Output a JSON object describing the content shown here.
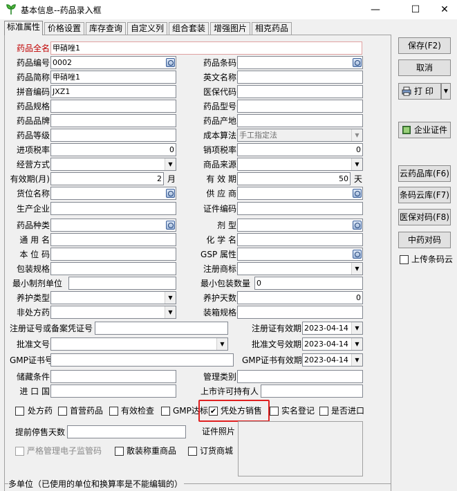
{
  "window": {
    "title": "基本信息--药品录入框",
    "minimize": "—",
    "maximize": "☐",
    "close": "✕"
  },
  "tabs": [
    "标准属性",
    "价格设置",
    "库存查询",
    "自定义列",
    "组合套装",
    "增强图片",
    "相克药品"
  ],
  "fields": {
    "full_name": {
      "label": "药品全名",
      "value": "甲硝唑1"
    },
    "code": {
      "label": "药品编号",
      "value": "0002"
    },
    "short_name": {
      "label": "药品简称",
      "value": "甲硝唑1"
    },
    "pinyin": {
      "label": "拼音编码",
      "value": "JXZ1"
    },
    "spec": {
      "label": "药品规格",
      "value": ""
    },
    "brand": {
      "label": "药品品牌",
      "value": ""
    },
    "grade": {
      "label": "药品等级",
      "value": ""
    },
    "input_tax": {
      "label": "进项税率",
      "value": "0"
    },
    "biz_mode": {
      "label": "经营方式",
      "value": ""
    },
    "validity": {
      "label": "有效期(月)",
      "value": "2",
      "unit": "月"
    },
    "location": {
      "label": "货位名称",
      "value": ""
    },
    "manufacturer": {
      "label": "生产企业",
      "value": ""
    },
    "category": {
      "label": "药品种类",
      "value": ""
    },
    "generic": {
      "label": "通 用 名",
      "value": ""
    },
    "base_unit": {
      "label": "本 位 码",
      "value": ""
    },
    "package_spec": {
      "label": "包装规格",
      "value": ""
    },
    "min_unit": {
      "label": "最小制剂单位",
      "value": ""
    },
    "care_type": {
      "label": "养护类型",
      "value": ""
    },
    "otc": {
      "label": "非处方药",
      "value": ""
    },
    "barcode": {
      "label": "药品条码",
      "value": ""
    },
    "en_name": {
      "label": "英文名称",
      "value": ""
    },
    "insurance": {
      "label": "医保代码",
      "value": ""
    },
    "model": {
      "label": "药品型号",
      "value": ""
    },
    "origin": {
      "label": "药品产地",
      "value": ""
    },
    "cost_method": {
      "label": "成本算法",
      "value": "手工指定法"
    },
    "output_tax": {
      "label": "销项税率",
      "value": "0"
    },
    "source": {
      "label": "商品来源",
      "value": ""
    },
    "validity_days": {
      "label": "有 效 期",
      "value": "50",
      "unit": "天"
    },
    "supplier": {
      "label": "供 应 商",
      "value": ""
    },
    "cert_code": {
      "label": "证件编码",
      "value": ""
    },
    "dosage": {
      "label": "剂    型",
      "value": ""
    },
    "chem_name": {
      "label": "化 学 名",
      "value": ""
    },
    "gsp": {
      "label": "GSP 属性",
      "value": ""
    },
    "trademark": {
      "label": "注册商标",
      "value": ""
    },
    "min_pack_qty": {
      "label": "最小包装数量",
      "value": "0"
    },
    "care_days": {
      "label": "养护天数",
      "value": "0"
    },
    "box_spec": {
      "label": "装箱规格",
      "value": ""
    },
    "reg_no": {
      "label": "注册证号或备案凭证号",
      "value": ""
    },
    "reg_expiry": {
      "label": "注册证有效期",
      "value": "2023-04-14"
    },
    "approval_no": {
      "label": "批准文号",
      "value": ""
    },
    "approval_expiry": {
      "label": "批准文号效期",
      "value": "2023-04-14"
    },
    "gmp_no": {
      "label": "GMP证书号",
      "value": ""
    },
    "gmp_expiry": {
      "label": "GMP证书有效期",
      "value": "2023-04-14"
    },
    "storage": {
      "label": "储藏条件",
      "value": ""
    },
    "mgmt_cat": {
      "label": "管理类别",
      "value": ""
    },
    "import_country": {
      "label": "进 口 国",
      "value": ""
    },
    "license_holder": {
      "label": "上市许可持有人",
      "value": ""
    },
    "stop_days": {
      "label": "提前停售天数",
      "value": ""
    },
    "cert_photo": {
      "label": "证件照片"
    }
  },
  "checks": {
    "rx": {
      "label": "处方药",
      "checked": false
    },
    "first_sale": {
      "label": "首营药品",
      "checked": false
    },
    "valid_check": {
      "label": "有效检查",
      "checked": false
    },
    "gmp": {
      "label": "GMP达标",
      "checked": false
    },
    "rx_sale": {
      "label": "凭处方销售",
      "checked": true
    },
    "real_name": {
      "label": "实名登记",
      "checked": false
    },
    "imported": {
      "label": "是否进口",
      "checked": false
    },
    "e_supervise": {
      "label": "严格管理电子监管码",
      "checked": false
    },
    "bulk": {
      "label": "散装称重商品",
      "checked": false
    },
    "order_mall": {
      "label": "订货商城",
      "checked": false
    },
    "upload_barcode": {
      "label": "上传条码云",
      "checked": false
    }
  },
  "side_buttons": {
    "save": "保存(F2)",
    "cancel": "取消",
    "print": "打  印",
    "cert": "企业证件",
    "cloud_lib": "云药品库(F6)",
    "barcode_lib": "条码云库(F7)",
    "insurance_match": "医保对码(F8)",
    "tcm_match": "中药对码"
  },
  "bottom_group": "多单位（已使用的单位和换算率是不能编辑的）",
  "check_mark": "✔"
}
